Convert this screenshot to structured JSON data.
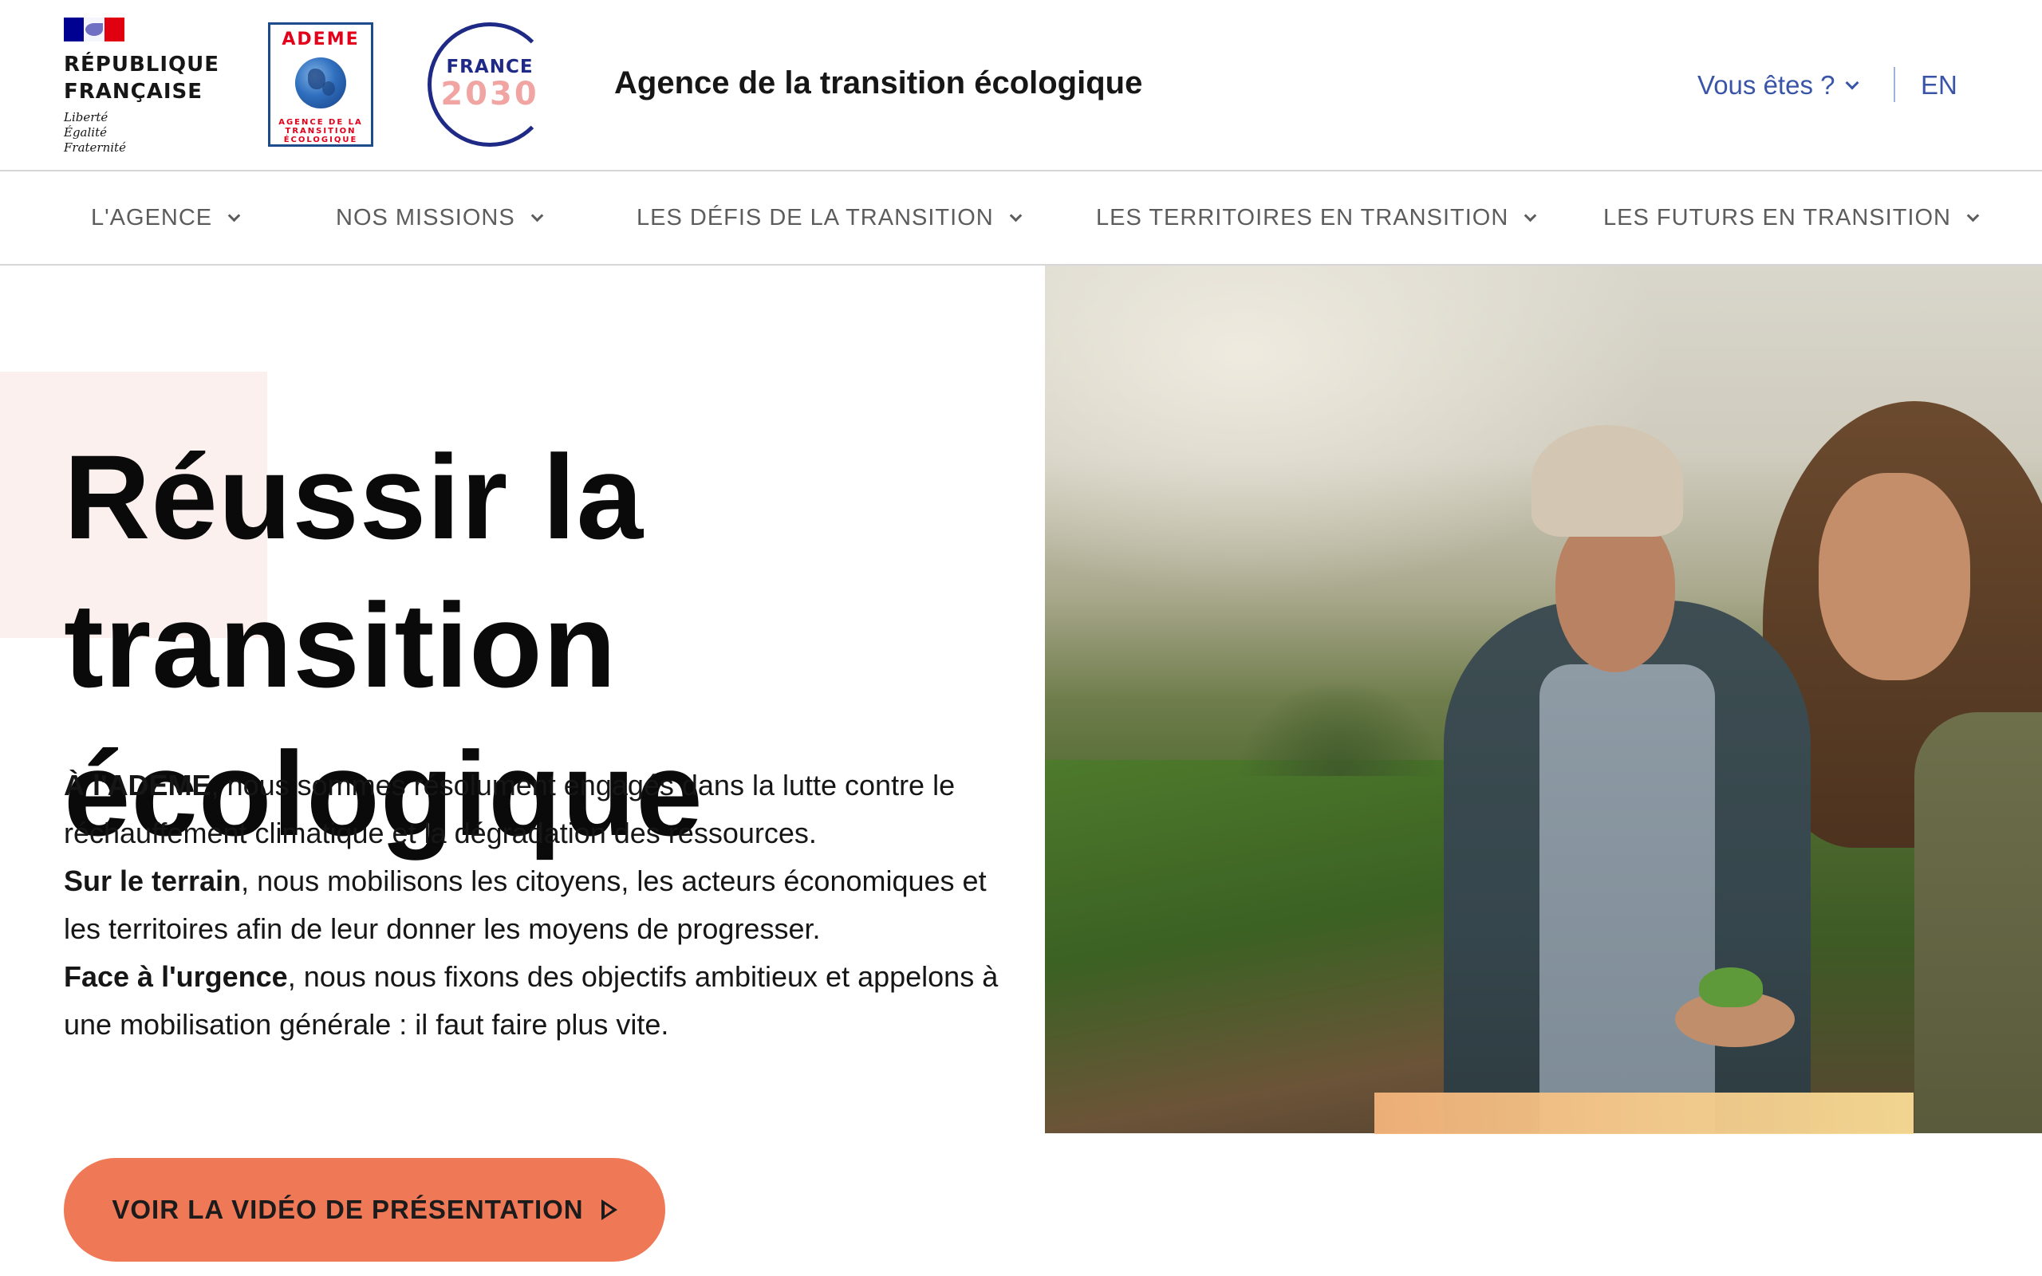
{
  "header": {
    "republique": {
      "name": "RÉPUBLIQUE\nFRANÇAISE",
      "motto": "Liberté\nÉgalité\nFraternité"
    },
    "ademe_logo": {
      "word": "ADEME",
      "subtitle": "AGENCE DE LA\nTRANSITION\nÉCOLOGIQUE"
    },
    "france2030_logo": {
      "word": "FRANCE",
      "year": "2030"
    },
    "agency_title": "Agence de la transition écologique",
    "who_menu_label": "Vous êtes ?",
    "language_label": "EN"
  },
  "nav": {
    "items": [
      {
        "label": "L'AGENCE",
        "icon": "chevron-down-icon"
      },
      {
        "label": "NOS MISSIONS",
        "icon": "chevron-down-icon"
      },
      {
        "label": "LES DÉFIS DE LA TRANSITION",
        "icon": "chevron-down-icon"
      },
      {
        "label": "LES TERRITOIRES EN TRANSITION",
        "icon": "chevron-down-icon"
      },
      {
        "label": "LES FUTURS EN TRANSITION",
        "icon": "chevron-down-icon"
      }
    ]
  },
  "hero": {
    "title_line1": "Réussir la transition",
    "title_line2": "écologique",
    "paragraphs": [
      {
        "bold": "À l'ADEME",
        "text": ", nous sommes résolument engagés dans la lutte contre le réchauffement climatique et la dégradation des ressources."
      },
      {
        "bold": "Sur le terrain",
        "text": ", nous mobilisons les citoyens, les acteurs économiques et les territoires afin de leur donner les moyens de progresser."
      },
      {
        "bold": "Face à l'urgence",
        "text": ", nous nous fixons des objectifs ambitieux et appelons à une mobilisation générale : il faut faire plus vite."
      }
    ],
    "cta_label": "VOIR LA VIDÉO DE PRÉSENTATION",
    "cta_icon": "play-icon"
  },
  "colors": {
    "accent_blue": "#3a55a7",
    "cta_orange": "#ef7857",
    "pink_block": "#fbf0ee",
    "republique_blue": "#000091",
    "republique_red": "#e1000f"
  }
}
